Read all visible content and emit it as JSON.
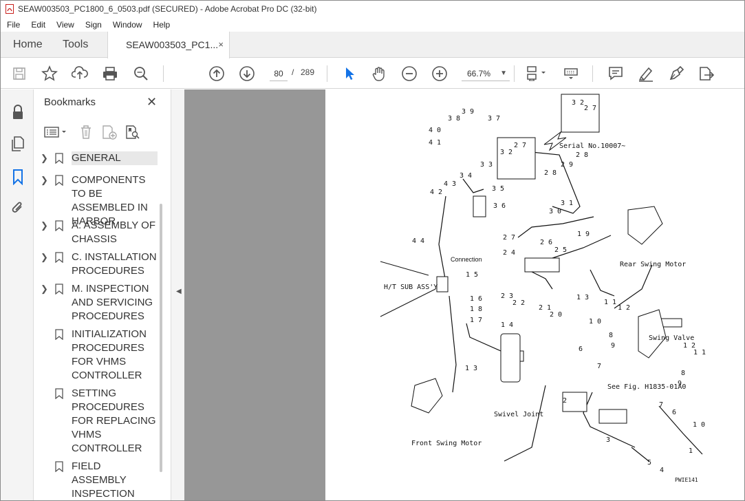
{
  "window": {
    "title": "SEAW003503_PC1800_6_0503.pdf (SECURED) - Adobe Acrobat Pro DC (32-bit)"
  },
  "menu": [
    "File",
    "Edit",
    "View",
    "Sign",
    "Window",
    "Help"
  ],
  "tabs": {
    "home": "Home",
    "tools": "Tools",
    "document": "SEAW003503_PC1...",
    "close": "×"
  },
  "toolbar": {
    "page_current": "80",
    "page_separator": "/",
    "page_total": "289",
    "zoom": "66.7%"
  },
  "bookmarks": {
    "title": "Bookmarks",
    "close": "✕",
    "items": [
      {
        "label": "GENERAL",
        "expandable": true,
        "selected": true
      },
      {
        "label": "COMPONENTS TO BE ASSEMBLED IN HARBOR",
        "expandable": true
      },
      {
        "label": "A. ASSEMBLY OF CHASSIS",
        "expandable": true
      },
      {
        "label": "C. INSTALLATION PROCEDURES",
        "expandable": true
      },
      {
        "label": "M. INSPECTION AND SERVICING PROCEDURES",
        "expandable": true
      },
      {
        "label": "INITIALIZATION PROCEDURES FOR VHMS CONTROLLER",
        "expandable": false
      },
      {
        "label": "SETTING PROCEDURES FOR REPLACING VHMS CONTROLLER",
        "expandable": false
      },
      {
        "label": "FIELD ASSEMBLY INSPECTION REPORT",
        "expandable": false
      }
    ]
  },
  "drawing": {
    "serial_note": "Serial No.10007~",
    "connection": "Connection",
    "ht_sub": "H/T SUB ASS'Y",
    "rear_motor": "Rear Swing Motor",
    "front_motor": "Front Swing Motor",
    "swivel": "Swivel Joint",
    "swing_valve": "Swing Valve",
    "see_fig": "See Fig. H1835-01A0",
    "code": "PWIE141"
  },
  "colors": {
    "accent_blue": "#1473e6",
    "pdf_red": "#c8201c",
    "viewer_gray": "#979797"
  }
}
